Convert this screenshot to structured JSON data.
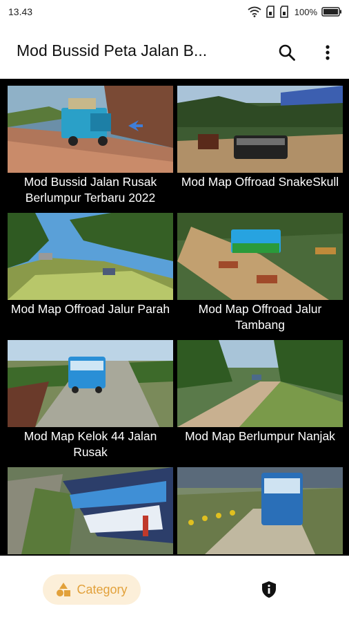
{
  "status_bar": {
    "time": "13.43",
    "battery": "100%"
  },
  "app_bar": {
    "title": "Mod Bussid Peta Jalan B...",
    "search_icon": "search-icon",
    "more_icon": "more-vert-icon"
  },
  "grid": {
    "items": [
      {
        "title": "Mod Bussid Jalan Rusak Berlumpur Terbaru 2022"
      },
      {
        "title": "Mod Map Offroad SnakeSkull"
      },
      {
        "title": "Mod Map Offroad Jalur Parah"
      },
      {
        "title": "Mod Map Offroad Jalur Tambang"
      },
      {
        "title": "Mod Map Kelok 44 Jalan Rusak"
      },
      {
        "title": "Mod Map Berlumpur Nanjak"
      },
      {
        "title": ""
      },
      {
        "title": ""
      }
    ]
  },
  "bottom_nav": {
    "category_label": "Category",
    "category_icon": "category-shapes-icon",
    "info_icon": "shield-info-icon",
    "accent_color": "#e2a13b"
  }
}
